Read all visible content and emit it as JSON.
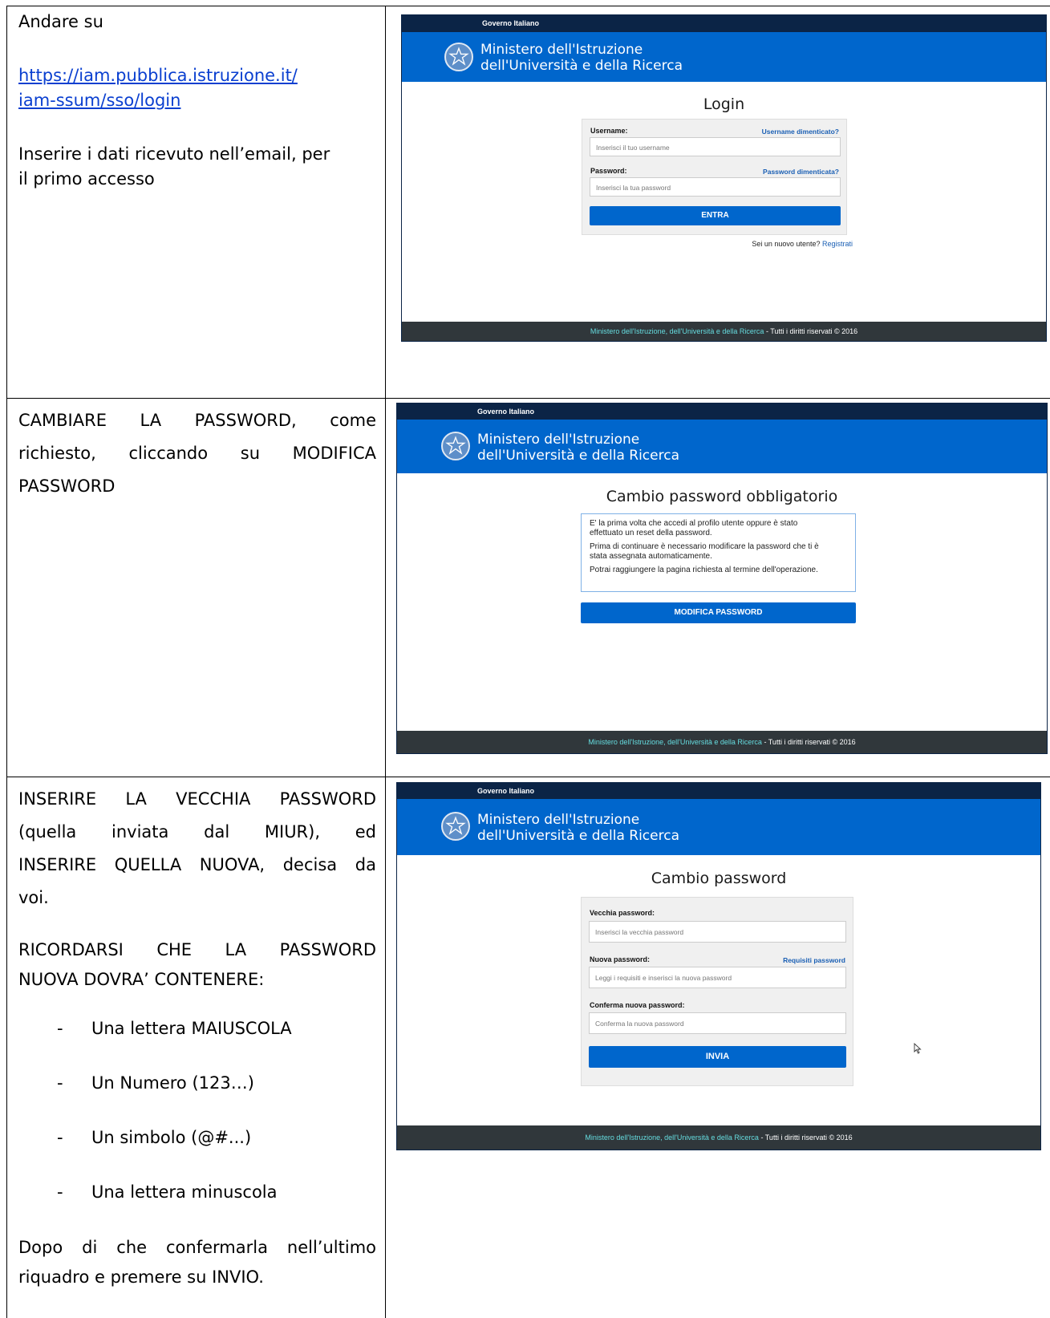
{
  "rows": [
    {
      "instructions": {
        "intro": "Andare su",
        "link_line1": "https://iam.pubblica.istruzione.it/",
        "link_line2": "iam-ssum/sso/login",
        "text_line1": "Inserire i dati ricevuto nell’email, per",
        "text_line2": "il primo accesso"
      },
      "screenshot": {
        "gov_label": "Governo Italiano",
        "ministry_line1": "Ministero dell'Istruzione",
        "ministry_line2": "dell'Università e della Ricerca",
        "page_title": "Login",
        "username_label": "Username:",
        "username_help": "Username dimenticato?",
        "username_placeholder": "Inserisci il tuo username",
        "password_label": "Password:",
        "password_help": "Password dimenticata?",
        "password_placeholder": "Inserisci la tua password",
        "submit_label": "ENTRA",
        "new_user_text": "Sei un nuovo utente?",
        "register_link": "Registrati",
        "footer_link": "Ministero dell'Istruzione, dell'Università e della Ricerca",
        "footer_text": "- Tutti i diritti riservati © 2016"
      }
    },
    {
      "instructions": {
        "line1": "CAMBIARE LA PASSWORD, come",
        "line2": "richiesto, cliccando su MODIFICA",
        "line3": "PASSWORD"
      },
      "screenshot": {
        "gov_label": "Governo Italiano",
        "ministry_line1": "Ministero dell'Istruzione",
        "ministry_line2": "dell'Università e della Ricerca",
        "page_title": "Cambio password obbligatorio",
        "info_p1_line1": "E' la prima volta che accedi al profilo utente oppure è stato",
        "info_p1_line2": "effettuato un reset della password.",
        "info_p2_line1": "Prima di continuare è necessario modificare la password che ti è",
        "info_p2_line2": "stata assegnata automaticamente.",
        "info_p3": "Potrai raggiungere la pagina richiesta al termine dell'operazione.",
        "button_label": "MODIFICA PASSWORD",
        "footer_link": "Ministero dell'Istruzione, dell'Università e della Ricerca",
        "footer_text": "- Tutti i diritti riservati © 2016"
      }
    },
    {
      "instructions": {
        "p1_line1": "INSERIRE LA VECCHIA PASSWORD",
        "p1_line2": "(quella inviata dal MIUR), ed",
        "p1_line3": "INSERIRE QUELLA NUOVA, decisa da",
        "p1_line4": "voi.",
        "p2_line1": "RICORDARSI CHE LA PASSWORD",
        "p2_line2": "NUOVA DOVRA’ CONTENERE:",
        "bullet_marker": "-",
        "bullets": [
          "Una lettera MAIUSCOLA",
          "Un Numero (123…)",
          "Un simbolo (@#...)",
          "Una lettera minuscola"
        ],
        "p3_line1": "Dopo di che confermarla nell’ultimo",
        "p3_line2": "riquadro e premere su INVIO."
      },
      "screenshot": {
        "gov_label": "Governo Italiano",
        "ministry_line1": "Ministero dell'Istruzione",
        "ministry_line2": "dell'Università e della Ricerca",
        "page_title": "Cambio password",
        "old_label": "Vecchia password:",
        "old_placeholder": "Inserisci la vecchia password",
        "new_label": "Nuova password:",
        "new_help": "Requisiti password",
        "new_placeholder": "Leggi i requisiti e inserisci la nuova password",
        "confirm_label": "Conferma nuova password:",
        "confirm_placeholder": "Conferma la nuova password",
        "submit_label": "INVIA",
        "footer_link": "Ministero dell'Istruzione, dell'Università e della Ricerca",
        "footer_text": "- Tutti i diritti riservati © 2016"
      }
    }
  ]
}
